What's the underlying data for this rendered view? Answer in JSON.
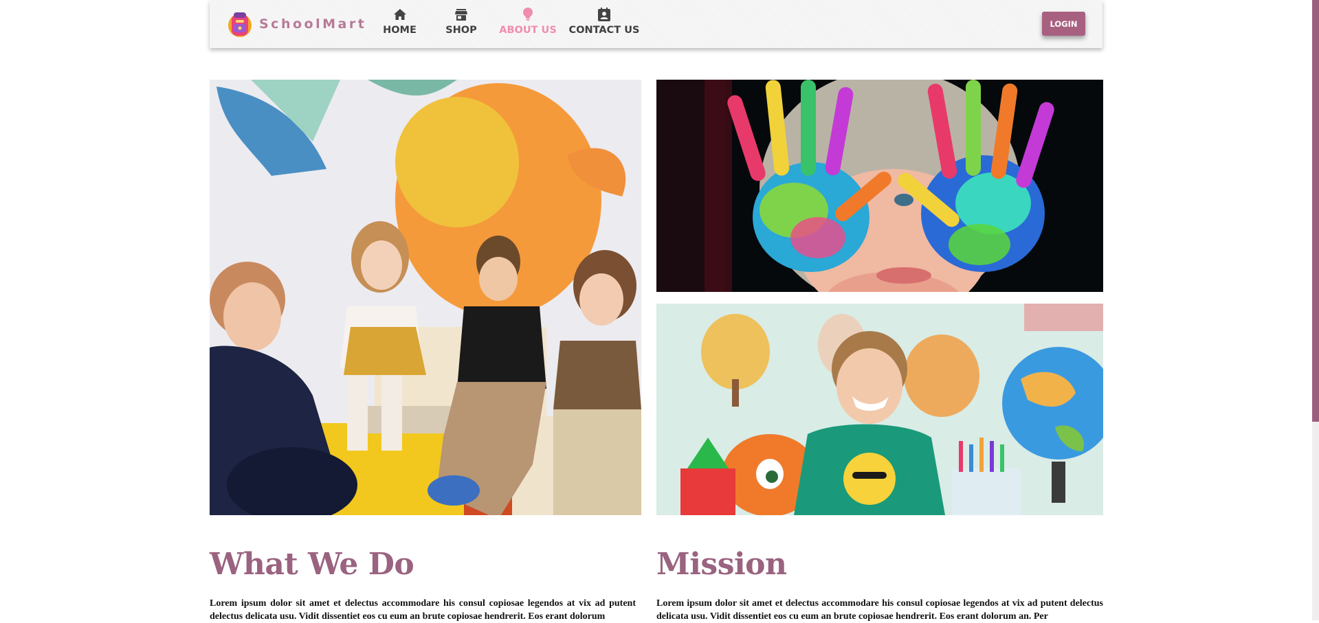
{
  "brand": {
    "name": "SchoolMart",
    "logo_icon": "backpack-icon"
  },
  "nav": {
    "items": [
      {
        "label": "HOME",
        "icon": "home-icon",
        "active": false
      },
      {
        "label": "SHOP",
        "icon": "store-icon",
        "active": false
      },
      {
        "label": "ABOUT US",
        "icon": "lightbulb-icon",
        "active": true
      },
      {
        "label": "CONTACT US",
        "icon": "contact-book-icon",
        "active": false
      }
    ],
    "login_label": "LOGIN"
  },
  "colors": {
    "accent": "#9a6380",
    "active_nav": "#f08cb0",
    "login_bg": "#a86080"
  },
  "sections": {
    "what_we_do": {
      "title": "What We Do",
      "body": "Lorem ipsum dolor sit amet et delectus accommodare his consul copiosae legendos at vix ad putent delectus delicata usu. Vidit dissentiet eos cu eum an brute copiosae hendrerit. Eos erant dolorum"
    },
    "mission": {
      "title": "Mission",
      "body": "Lorem ipsum dolor sit amet et delectus accommodare his consul copiosae legendos at vix ad putent delectus delicata usu. Vidit dissentiet eos cu eum an brute copiosae hendrerit. Eos erant dolorum an. Per"
    }
  }
}
